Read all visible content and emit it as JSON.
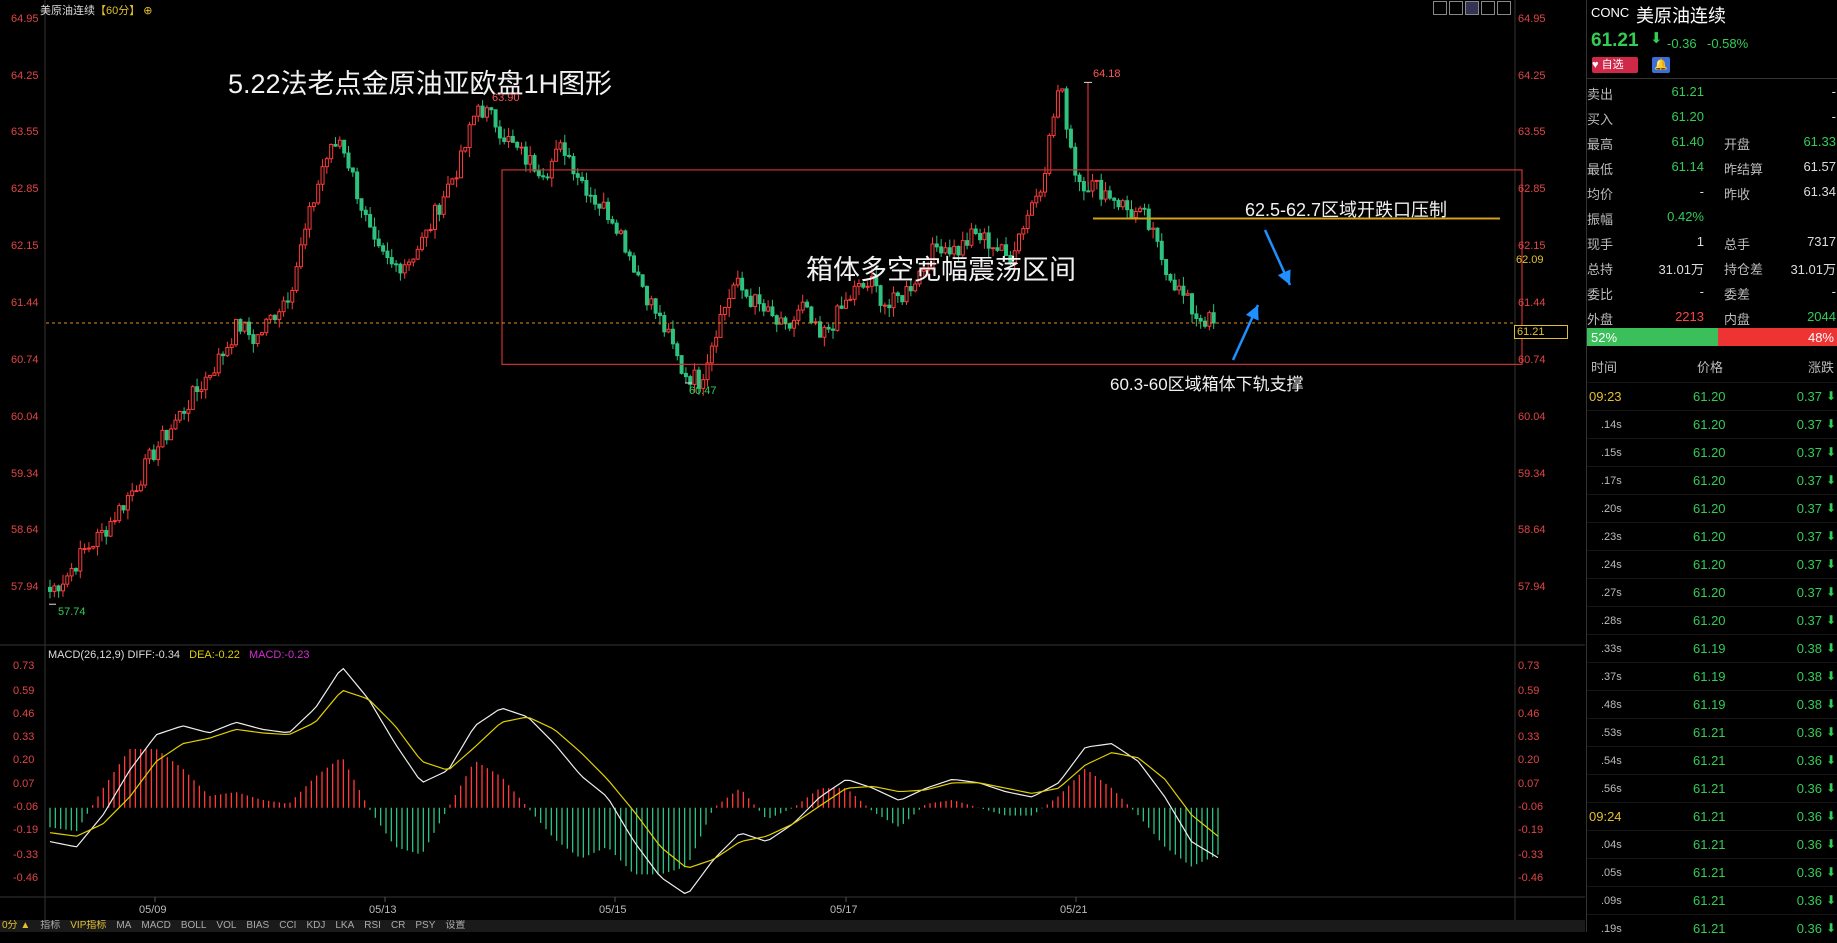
{
  "chart_title": "美原油连续",
  "period": "【60分】",
  "annotations": {
    "main_title": "5.22法老点金原油亚欧盘1H图形",
    "box_label": "箱体多空宽幅震荡区间",
    "resistance_label": "62.5-62.7区域开跌口压制",
    "support_label": "60.3-60区域箱体下轨支撑"
  },
  "price_axis_ticks": [
    "64.95",
    "64.25",
    "63.55",
    "62.85",
    "62.15",
    "61.44",
    "60.74",
    "60.04",
    "59.34",
    "58.64",
    "57.94"
  ],
  "price_markers": {
    "high": "64.18",
    "high2": "63.90",
    "low": "60.47",
    "low2": "57.74",
    "current": "61.21",
    "line_level": "62.09"
  },
  "macd_header": {
    "name": "MACD(26,12,9)",
    "diff": "DIFF:-0.34",
    "dea": "DEA:-0.22",
    "macd": "MACD:-0.23"
  },
  "macd_axis_ticks": [
    "0.73",
    "0.59",
    "0.46",
    "0.33",
    "0.20",
    "0.07",
    "-0.06",
    "-0.19",
    "-0.33",
    "-0.46"
  ],
  "date_labels": [
    "05/09",
    "05/13",
    "05/15",
    "05/17",
    "05/21"
  ],
  "bottom_tabs": [
    "指标",
    "VIP指标",
    "MA",
    "MACD",
    "BOLL",
    "VOL",
    "BIAS",
    "CCI",
    "KDJ",
    "LKA",
    "RSI",
    "CR",
    "PSY",
    "设置"
  ],
  "period_indicator": "0分 ▲",
  "colors": {
    "up": "#ff3b3b",
    "down": "#2ec27e",
    "box": "#d03030",
    "resistance": "#d4a017",
    "arrow": "#1e90ff",
    "dea": "#e0d000",
    "macd": "#d030d0"
  },
  "panel": {
    "code": "CONC",
    "name": "美原油连续",
    "price": "61.21",
    "change": "-0.36",
    "change_pct": "-0.58%",
    "fav_label": "自选",
    "rows": [
      {
        "l1": "卖出",
        "v1": "61.21",
        "l2": "",
        "v2": "-",
        "c1": "green"
      },
      {
        "l1": "买入",
        "v1": "61.20",
        "l2": "",
        "v2": "-",
        "c1": "green"
      },
      {
        "l1": "最高",
        "v1": "61.40",
        "l2": "开盘",
        "v2": "61.33",
        "c1": "green",
        "c2": "green"
      },
      {
        "l1": "最低",
        "v1": "61.14",
        "l2": "昨结算",
        "v2": "61.57",
        "c1": "green",
        "c2": "white"
      },
      {
        "l1": "均价",
        "v1": "-",
        "l2": "昨收",
        "v2": "61.34",
        "c1": "white",
        "c2": "white"
      },
      {
        "l1": "振幅",
        "v1": "0.42%",
        "l2": "",
        "v2": "",
        "c1": "green"
      },
      {
        "l1": "现手",
        "v1": "1",
        "l2": "总手",
        "v2": "7317",
        "c1": "white",
        "c2": "white"
      },
      {
        "l1": "总持",
        "v1": "31.01万",
        "l2": "持仓差",
        "v2": "31.01万",
        "c1": "white",
        "c2": "white"
      },
      {
        "l1": "委比",
        "v1": "-",
        "l2": "委差",
        "v2": "-",
        "c1": "white",
        "c2": "white"
      },
      {
        "l1": "外盘",
        "v1": "2213",
        "l2": "内盘",
        "v2": "2044",
        "c1": "red",
        "c2": "green"
      }
    ],
    "buy_ratio": "52%",
    "sell_ratio": "48%",
    "buy_fraction": 0.52,
    "tick_headers": [
      "时间",
      "价格",
      "涨跌"
    ],
    "ticks": [
      {
        "t": "09:23",
        "p": "61.20",
        "c": "0.37"
      },
      {
        "t": ".14s",
        "p": "61.20",
        "c": "0.37"
      },
      {
        "t": ".15s",
        "p": "61.20",
        "c": "0.37"
      },
      {
        "t": ".17s",
        "p": "61.20",
        "c": "0.37"
      },
      {
        "t": ".20s",
        "p": "61.20",
        "c": "0.37"
      },
      {
        "t": ".23s",
        "p": "61.20",
        "c": "0.37"
      },
      {
        "t": ".24s",
        "p": "61.20",
        "c": "0.37"
      },
      {
        "t": ".27s",
        "p": "61.20",
        "c": "0.37"
      },
      {
        "t": ".28s",
        "p": "61.20",
        "c": "0.37"
      },
      {
        "t": ".33s",
        "p": "61.19",
        "c": "0.38"
      },
      {
        "t": ".37s",
        "p": "61.19",
        "c": "0.38"
      },
      {
        "t": ".48s",
        "p": "61.19",
        "c": "0.38"
      },
      {
        "t": ".53s",
        "p": "61.21",
        "c": "0.36"
      },
      {
        "t": ".54s",
        "p": "61.21",
        "c": "0.36"
      },
      {
        "t": ".56s",
        "p": "61.21",
        "c": "0.36"
      },
      {
        "t": "09:24",
        "p": "61.21",
        "c": "0.36"
      },
      {
        "t": ".04s",
        "p": "61.21",
        "c": "0.36"
      },
      {
        "t": ".05s",
        "p": "61.21",
        "c": "0.36"
      },
      {
        "t": ".09s",
        "p": "61.21",
        "c": "0.36"
      },
      {
        "t": ".19s",
        "p": "61.21",
        "c": "0.36"
      }
    ]
  },
  "chart_data": {
    "type": "candlestick",
    "symbol": "美原油连续",
    "interval": "60分",
    "ylim": [
      57.6,
      65.0
    ],
    "dates": [
      "05/09",
      "05/13",
      "05/15",
      "05/17",
      "05/21"
    ],
    "close_path": [
      57.9,
      58.1,
      58.4,
      58.6,
      58.9,
      59.2,
      59.6,
      59.9,
      60.2,
      60.5,
      60.8,
      61.2,
      61.0,
      61.3,
      61.6,
      62.4,
      63.2,
      63.5,
      62.8,
      62.1,
      61.9,
      62.0,
      62.3,
      62.8,
      63.2,
      63.9,
      63.7,
      63.4,
      63.2,
      63.1,
      63.4,
      63.0,
      62.7,
      62.5,
      62.0,
      61.5,
      61.1,
      60.6,
      60.5,
      61.2,
      61.7,
      61.5,
      61.3,
      61.1,
      61.4,
      61.0,
      61.3,
      61.6,
      61.7,
      61.4,
      61.6,
      61.9,
      62.2,
      62.1,
      62.3,
      62.2,
      62.0,
      62.5,
      63.0,
      64.18,
      63.0,
      62.9,
      62.8,
      62.6,
      62.5,
      62.0,
      61.6,
      61.3,
      61.21
    ],
    "box": {
      "top": 63.1,
      "bottom": 60.7
    },
    "resistance_line": 62.5,
    "current_price": 61.21,
    "macd": {
      "diff_end": -0.34,
      "dea_end": -0.22,
      "macd_end": -0.23,
      "diff": [
        -0.25,
        -0.28,
        -0.1,
        0.15,
        0.35,
        0.4,
        0.36,
        0.42,
        0.38,
        0.36,
        0.5,
        0.73,
        0.55,
        0.3,
        0.08,
        0.15,
        0.4,
        0.5,
        0.45,
        0.3,
        0.12,
        0.0,
        -0.25,
        -0.45,
        -0.55,
        -0.35,
        -0.2,
        -0.25,
        -0.15,
        0.0,
        0.1,
        0.05,
        -0.02,
        0.05,
        0.1,
        0.08,
        0.03,
        0.0,
        0.08,
        0.28,
        0.3,
        0.2,
        0.0,
        -0.25,
        -0.34
      ],
      "dea": [
        -0.2,
        -0.22,
        -0.15,
        0.0,
        0.2,
        0.3,
        0.33,
        0.38,
        0.36,
        0.35,
        0.42,
        0.6,
        0.55,
        0.4,
        0.2,
        0.15,
        0.28,
        0.42,
        0.45,
        0.38,
        0.25,
        0.1,
        -0.08,
        -0.28,
        -0.4,
        -0.35,
        -0.25,
        -0.22,
        -0.15,
        -0.05,
        0.05,
        0.06,
        0.03,
        0.04,
        0.08,
        0.08,
        0.05,
        0.02,
        0.05,
        0.18,
        0.25,
        0.22,
        0.1,
        -0.1,
        -0.22
      ]
    }
  }
}
